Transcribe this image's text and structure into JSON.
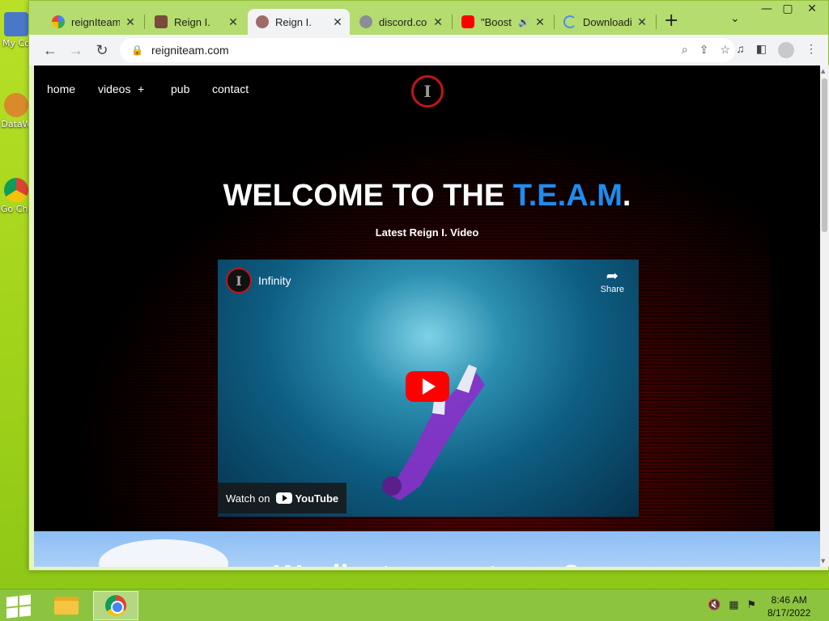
{
  "desktop": {
    "icons": [
      {
        "label": "My Co"
      },
      {
        "label": "DataW"
      },
      {
        "label": "Go Chr"
      }
    ]
  },
  "browser": {
    "tabs": [
      {
        "title": "reignIteam"
      },
      {
        "title": "Reign I."
      },
      {
        "title": "Reign I."
      },
      {
        "title": "discord.com"
      },
      {
        "title": "\"Boost"
      },
      {
        "title": "Downloadi"
      }
    ],
    "url": "reigniteam.com"
  },
  "site": {
    "nav": {
      "home": "home",
      "videos": "videos",
      "videos_plus": "+",
      "pub": "pub",
      "contact": "contact"
    },
    "logo_letter": "I",
    "hero": {
      "title_prefix": "WELCOME TO THE ",
      "title_team": "T.E.A.M",
      "title_suffix": ".",
      "subtitle": "Latest Reign I. Video"
    },
    "video": {
      "channel_letter": "I",
      "title": "Infinity",
      "share_label": "Share",
      "watch_on": "Watch on",
      "youtube": "YouTube"
    },
    "next_section_text": "W...  ll...  t...  ...  ...  t...  ...  ?"
  },
  "taskbar": {
    "time": "8:46 AM",
    "date": "8/17/2022"
  },
  "colors": {
    "accent_blue": "#1e8cf0",
    "brand_red": "#c3141b",
    "taskbar_green": "#8dc43f"
  }
}
